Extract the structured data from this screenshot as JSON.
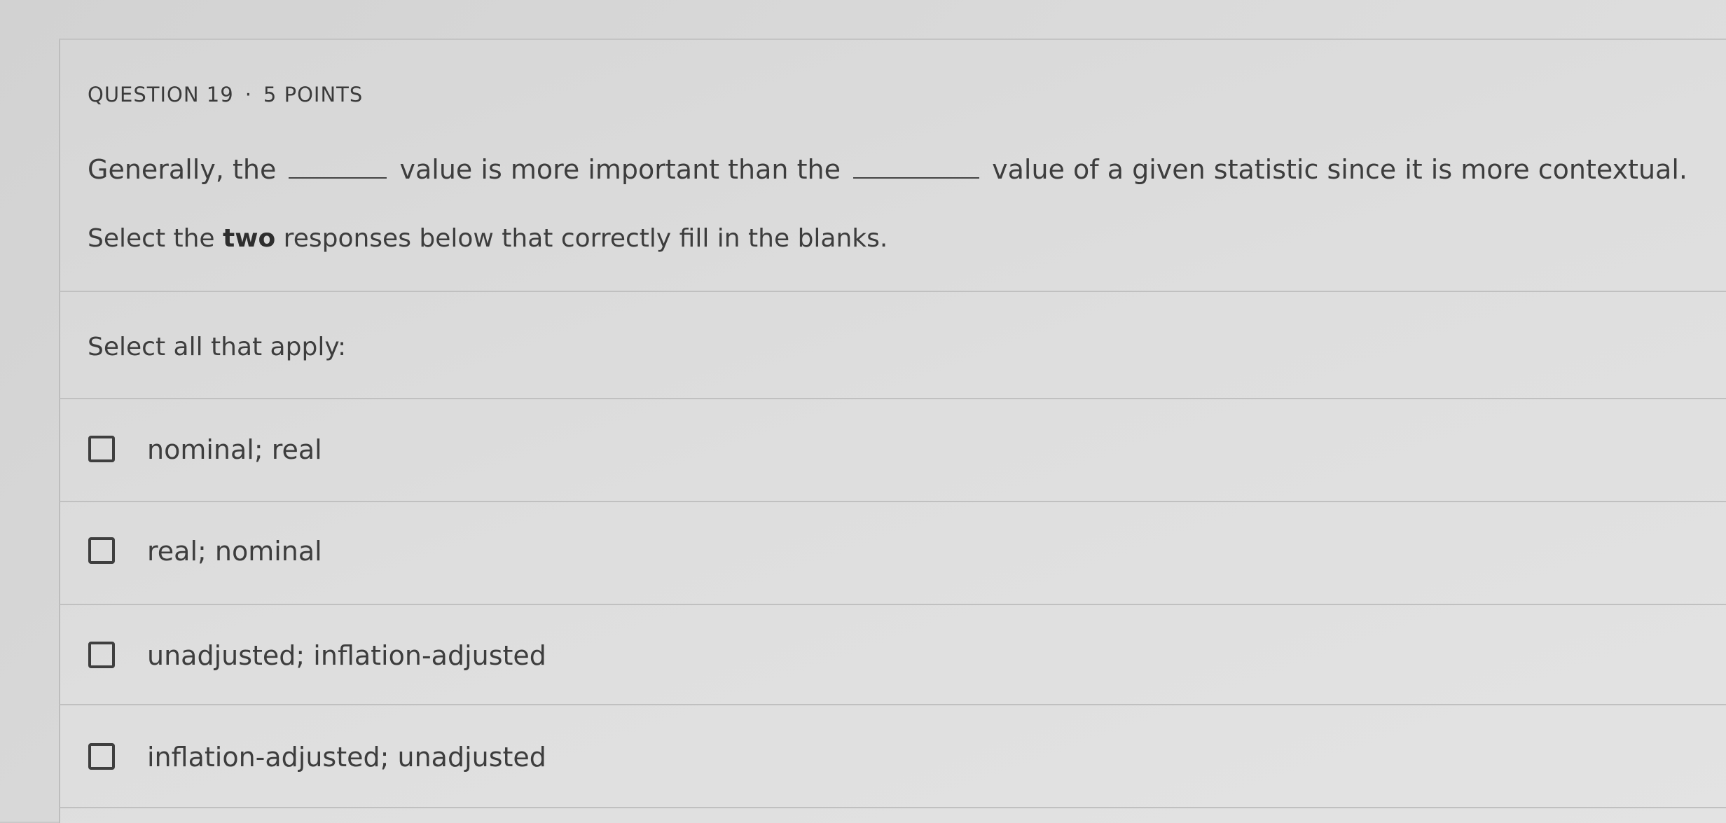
{
  "question": {
    "number_label": "QUESTION 19",
    "separator": "·",
    "points_label": "5 POINTS",
    "prompt_part1": "Generally, the",
    "prompt_part2": "value is more important than the",
    "prompt_part3": "value of a given statistic since it is more contextual.",
    "instruction_prefix": "Select the ",
    "instruction_emphasis": "two",
    "instruction_suffix": " responses below that correctly fill in the blanks."
  },
  "answers": {
    "select_all_label": "Select all that apply:",
    "options": [
      {
        "label": "nominal; real",
        "checked": false
      },
      {
        "label": "real; nominal",
        "checked": false
      },
      {
        "label": "unadjusted; inflation-adjusted",
        "checked": false
      },
      {
        "label": "inflation-adjusted; unadjusted",
        "checked": false
      }
    ]
  }
}
